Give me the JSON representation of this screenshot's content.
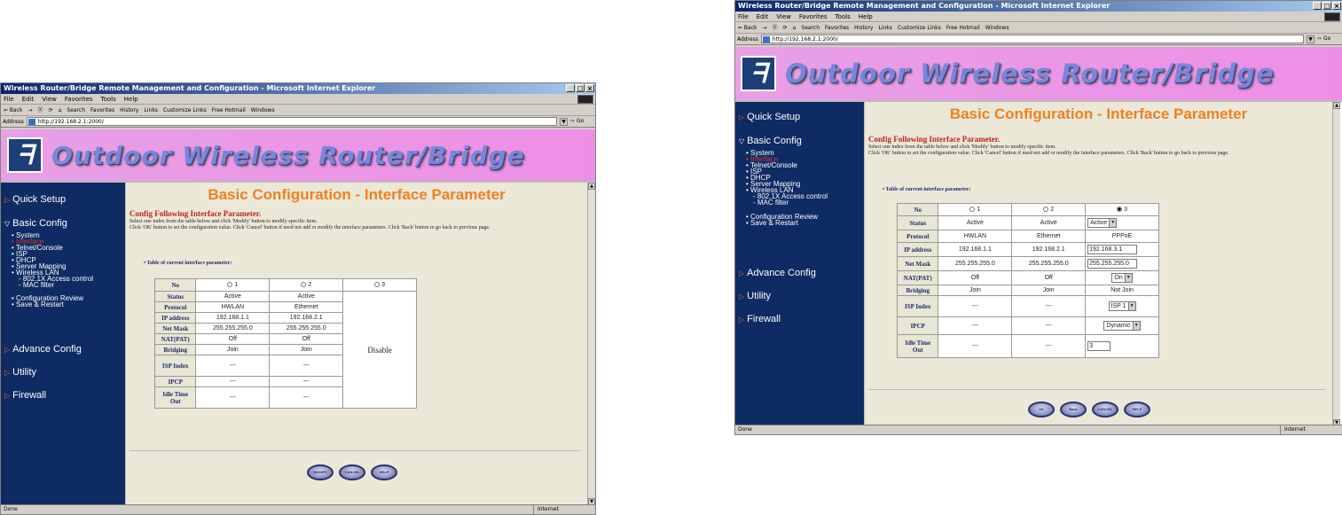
{
  "browser": {
    "title": "Wireless Router/Bridge Remote Management and Configuration - Microsoft Internet Explorer",
    "menu": [
      "File",
      "Edit",
      "View",
      "Favorites",
      "Tools",
      "Help"
    ],
    "toolbar": [
      "⇐ Back",
      "→",
      "Ⓧ",
      "⟳",
      "⌂",
      "Search",
      "Favorites",
      "History",
      "Links",
      "Customize Links",
      "Free Hotmail",
      "Windows"
    ],
    "address_label": "Address",
    "address_value": "http://192.168.2.1:2000/",
    "go_label": "Go",
    "status_left": "Done",
    "status_zone": "Internet"
  },
  "banner_title": "Outdoor Wireless Router/Bridge",
  "logo_glyph": "ᖷ",
  "sidebar": {
    "quick_setup": "Quick Setup",
    "basic_config": "Basic Config",
    "sub_items": [
      "System",
      "Interface",
      "Telnet/Console",
      "ISP",
      "DHCP",
      "Server Mapping",
      "Wireless LAN",
      "- 802.1X Access control",
      "- MAC filter"
    ],
    "sub_items2": [
      "Configuration Review",
      "Save & Restart"
    ],
    "advance_config": "Advance Config",
    "utility": "Utility",
    "firewall": "Firewall"
  },
  "page": {
    "heading": "Basic Configuration - Interface Parameter",
    "subheading": "Config Following Interface Parameter.",
    "desc1": "Select one index from the table below and click 'Modify' button to modify specific item.",
    "desc2": "Click 'OK' button to set the configuration value. Click 'Cancel' button if need not add or modify the interface parameters. Click 'Back' button to go back to previous page.",
    "table_title": "Table of current interface parameter:"
  },
  "table": {
    "row_labels": [
      "No",
      "Status",
      "Protocol",
      "IP address",
      "Net Mask",
      "NAT(PAT)",
      "Bridging",
      "ISP Index",
      "IPCP",
      "Idle Time Out"
    ],
    "col1": {
      "no": "1",
      "status": "Active",
      "protocol": "HWLAN",
      "ip": "192.168.1.1",
      "mask": "255.255.255.0",
      "nat": "Off",
      "bridging": "Join",
      "isp": "---",
      "ipcp": "---",
      "idle": "---"
    },
    "col2": {
      "no": "2",
      "status": "Active",
      "protocol": "Ethernet",
      "ip": "192.168.2.1",
      "mask": "255.255.255.0",
      "nat": "Off",
      "bridging": "Join",
      "isp": "---",
      "ipcp": "---",
      "idle": "---"
    },
    "col3_disabled": {
      "no": "3",
      "disable": "Disable"
    },
    "col3_edit": {
      "no": "3",
      "status": "Active",
      "protocol": "PPPoE",
      "ip": "192.168.3.1",
      "mask": "255.255.255.0",
      "nat": "On",
      "bridging": "Not Join",
      "isp": "ISP 1",
      "ipcp": "Dynamic",
      "idle": "3"
    }
  },
  "buttons_left": [
    "MODIFY",
    "CANCEL",
    "HELP"
  ],
  "buttons_right": [
    "OK",
    "Back",
    "CANCEL",
    "HELP"
  ],
  "colors": {
    "heading": "#f08020",
    "sidebar": "#0e2b63",
    "banner": "#ee8fe6",
    "panel": "#ebe8d8"
  }
}
